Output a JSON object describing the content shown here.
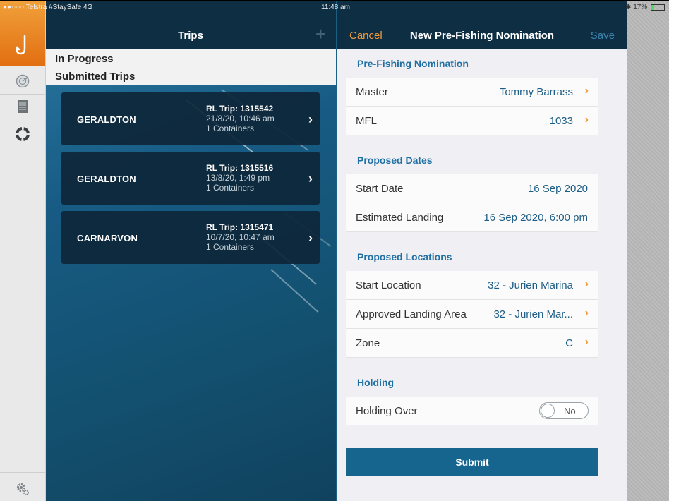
{
  "status_bar": {
    "carrier": "●●○○○ Telstra #StaySafe  4G",
    "time": "11:48 am",
    "battery": "17%"
  },
  "trips_panel": {
    "title": "Trips",
    "add_icon": "plus-icon",
    "segments": [
      "In Progress",
      "Submitted Trips"
    ],
    "trips": [
      {
        "port": "GERALDTON",
        "trip_id": "RL Trip: 1315542",
        "datetime": "21/8/20, 10:46 am",
        "containers": "1 Containers"
      },
      {
        "port": "GERALDTON",
        "trip_id": "RL Trip: 1315516",
        "datetime": "13/8/20, 1:49 pm",
        "containers": "1 Containers"
      },
      {
        "port": "CARNARVON",
        "trip_id": "RL Trip: 1315471",
        "datetime": "10/7/20, 10:47 am",
        "containers": "1 Containers"
      }
    ]
  },
  "form": {
    "cancel_label": "Cancel",
    "title": "New Pre-Fishing Nomination",
    "save_label": "Save",
    "sections": {
      "nomination": {
        "header": "Pre-Fishing Nomination",
        "master_label": "Master",
        "master_value": "Tommy Barrass",
        "mfl_label": "MFL",
        "mfl_value": "1033"
      },
      "dates": {
        "header": "Proposed Dates",
        "start_label": "Start Date",
        "start_value": "16 Sep 2020",
        "landing_label": "Estimated Landing",
        "landing_value": "16 Sep 2020, 6:00 pm"
      },
      "locations": {
        "header": "Proposed Locations",
        "start_label": "Start Location",
        "start_value": "32 - Jurien Marina",
        "area_label": "Approved Landing Area",
        "area_value": "32 - Jurien Mar...",
        "zone_label": "Zone",
        "zone_value": "C"
      },
      "holding": {
        "header": "Holding",
        "over_label": "Holding Over",
        "over_value": "No"
      }
    },
    "submit_label": "Submit"
  },
  "colors": {
    "nav_bg": "#0e2e44",
    "accent_orange": "#f29a37",
    "section_blue": "#1f6fa3",
    "submit_bg": "#16658f"
  }
}
